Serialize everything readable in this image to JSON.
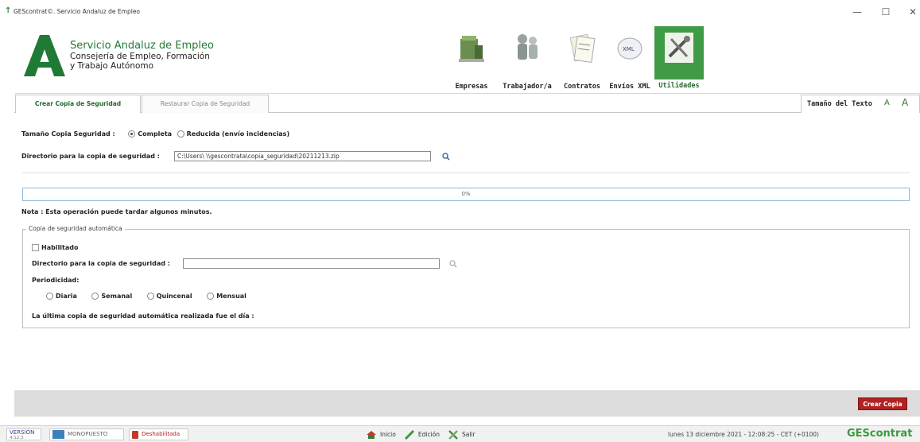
{
  "window": {
    "title": "GEScontrat©. Servicio Andaluz de Empleo",
    "min_glyph": "—",
    "max_glyph": "☐",
    "close_glyph": "✕"
  },
  "header": {
    "org_line1": "Servicio Andaluz de Empleo",
    "org_line2": "Consejería de Empleo, Formación",
    "org_line3": "y Trabajo Autónomo",
    "nav": [
      {
        "label": "Empresas",
        "icon": "companies-icon"
      },
      {
        "label": "Trabajador/a",
        "icon": "workers-icon"
      },
      {
        "label": "Contratos",
        "icon": "contracts-icon"
      },
      {
        "label": "Envíos XML",
        "icon": "xml-icon"
      },
      {
        "label": "Utilidades",
        "icon": "tools-icon",
        "active": true
      }
    ]
  },
  "tabs": {
    "create": "Crear Copia de Seguridad",
    "restore": "Restaurar Copia de Seguridad",
    "text_size": "Tamaño del Texto"
  },
  "form": {
    "size_label": "Tamaño Copia Seguridad :",
    "size_options": [
      "Completa",
      "Reducida (envío incidencias)"
    ],
    "size_selected": "Completa",
    "dir_label": "Directorio para la copia de seguridad :",
    "dir_value": "C:\\Users\\           \\\\gescontrata\\copia_seguridad\\20211213.zip",
    "progress": "0%",
    "progress_value": 0,
    "note": "Nota : Esta operación puede tardar algunos minutos."
  },
  "auto": {
    "legend": "Copia de seguridad automática",
    "enabled_label": "Habilitado",
    "enabled": false,
    "dir_label": "Directorio para la copia de seguridad :",
    "dir_value": "",
    "period_label": "Periodicidad:",
    "period_options": [
      "Diaria",
      "Semanal",
      "Quincenal",
      "Mensual"
    ],
    "last_label": "La última copia de seguridad automática realizada fue el día :"
  },
  "actions": {
    "create_copy": "Crear Copia"
  },
  "status": {
    "version_label": "VERSIÓN",
    "version_number": "4.12.3",
    "mode": "MONOPUESTO",
    "state": "Deshabilitada",
    "inicio": "Inicio",
    "edicion": "Edición",
    "salir": "Salir",
    "datetime": "lunes 13 diciembre 2021 - 12:08:25 - CET (+0100)",
    "brand": "GEScontrat"
  },
  "colors": {
    "brand_green": "#3a9b3d",
    "tab_green": "#1f6a2c",
    "action_red": "#b22222"
  }
}
